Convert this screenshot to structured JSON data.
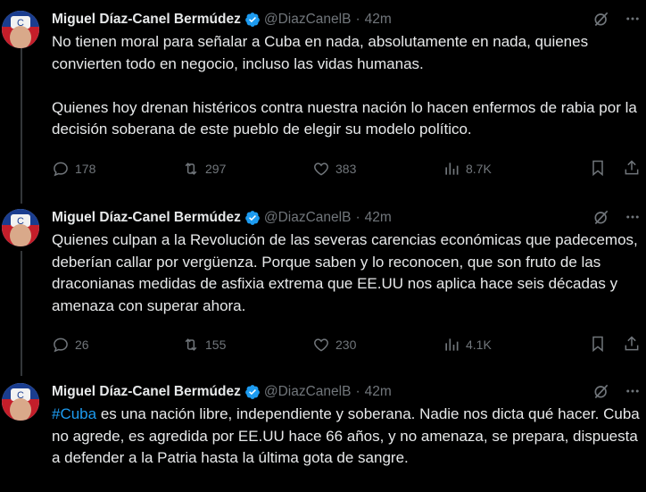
{
  "tweets": [
    {
      "author": "Miguel Díaz-Canel Bermúdez",
      "handle": "@DiazCanelB",
      "dot": "·",
      "time": "42m",
      "paragraphs": [
        "No tienen moral para señalar a Cuba en nada, absolutamente en nada, quienes convierten todo en negocio, incluso las vidas humanas.",
        "Quienes hoy drenan histéricos contra nuestra nación lo hacen enfermos de rabia por la decisión soberana de este pueblo de elegir su modelo político."
      ],
      "replies": "178",
      "reposts": "297",
      "likes": "383",
      "views": "8.7K"
    },
    {
      "author": "Miguel Díaz-Canel Bermúdez",
      "handle": "@DiazCanelB",
      "dot": "·",
      "time": "42m",
      "paragraphs": [
        "Quienes culpan a la Revolución de las severas carencias económicas que padecemos, deberían callar por vergüenza. Porque saben y lo reconocen, que son fruto de las draconianas medidas de asfixia extrema que EE.UU nos aplica hace seis décadas y amenaza con superar ahora."
      ],
      "replies": "26",
      "reposts": "155",
      "likes": "230",
      "views": "4.1K"
    },
    {
      "author": "Miguel Díaz-Canel Bermúdez",
      "handle": "@DiazCanelB",
      "dot": "·",
      "time": "42m",
      "hashtag": "#Cuba",
      "paragraphs": [
        " es una nación libre, independiente y soberana. Nadie nos dicta qué hacer. Cuba no agrede, es agredida por EE.UU hace 66 años, y no amenaza, se prepara, dispuesta a defender a la Patria hasta la última gota de sangre."
      ]
    }
  ],
  "colors": {
    "background": "#000000",
    "text": "#e7e9ea",
    "muted": "#71767b",
    "link": "#1d9bf0",
    "verified": "#1d9bf0"
  }
}
